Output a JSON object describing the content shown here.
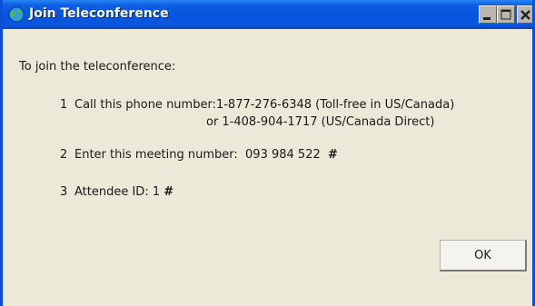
{
  "window": {
    "title": "Join Teleconference"
  },
  "content": {
    "heading": "To join the teleconference:",
    "steps": [
      {
        "number": "1",
        "lead": "Call this phone number:",
        "primary": "1-877-276-6348 (Toll-free in US/Canada)",
        "secondary": "or 1-408-904-1717 (US/Canada Direct)"
      },
      {
        "number": "2",
        "lead": "Enter this meeting number:",
        "value": "093 984 522",
        "suffix": "#"
      },
      {
        "number": "3",
        "lead": "Attendee ID:",
        "value": "1",
        "suffix": "#"
      }
    ]
  },
  "buttons": {
    "ok_label": "OK"
  },
  "colors": {
    "titlebar": "#0654dd",
    "window_border": "#0a4fd6",
    "body_background": "#ece9d8"
  }
}
